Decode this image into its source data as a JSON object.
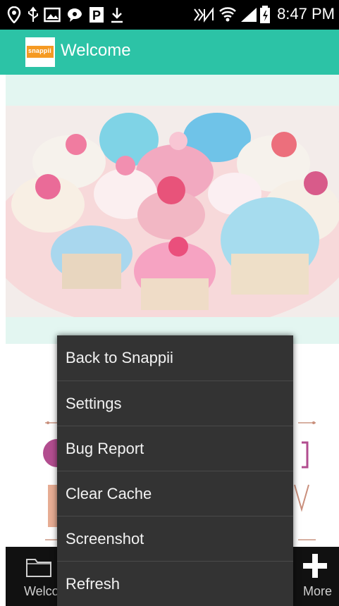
{
  "status_bar": {
    "time": "8:47 PM"
  },
  "app_bar": {
    "title": "Welcome",
    "logo_text": "snappii"
  },
  "menu": {
    "items": [
      {
        "label": "Back to Snappii"
      },
      {
        "label": "Settings"
      },
      {
        "label": "Bug Report"
      },
      {
        "label": "Clear Cache"
      },
      {
        "label": "Screenshot"
      },
      {
        "label": "Refresh"
      }
    ]
  },
  "bottom_nav": {
    "tabs": [
      {
        "label": "Welcome",
        "icon": "folder-icon"
      },
      {
        "label": "More",
        "icon": "plus-icon"
      }
    ]
  },
  "colors": {
    "accent": "#2cc3a6",
    "mint": "#e3f6f1",
    "menu_bg": "#333333"
  }
}
